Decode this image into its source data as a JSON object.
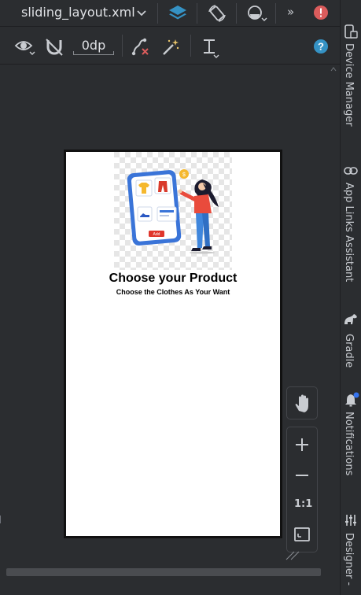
{
  "toolbar": {
    "file_tab": "sliding_layout.xml",
    "margin_value": "0dp"
  },
  "preview": {
    "title": "Choose your Product",
    "subtitle": "Choose the Clothes As Your Want",
    "illustration_button": "Add"
  },
  "zoom": {
    "ratio": "1:1"
  },
  "tool_windows": {
    "device_manager": "Device Manager",
    "app_links": "App Links Assistant",
    "gradle": "Gradle",
    "notifications": "Notifications",
    "designer": "Designer - "
  },
  "colors": {
    "accent_blue": "#3592c4",
    "error_red": "#db5c5c",
    "notification_dot": "#3574f0"
  }
}
